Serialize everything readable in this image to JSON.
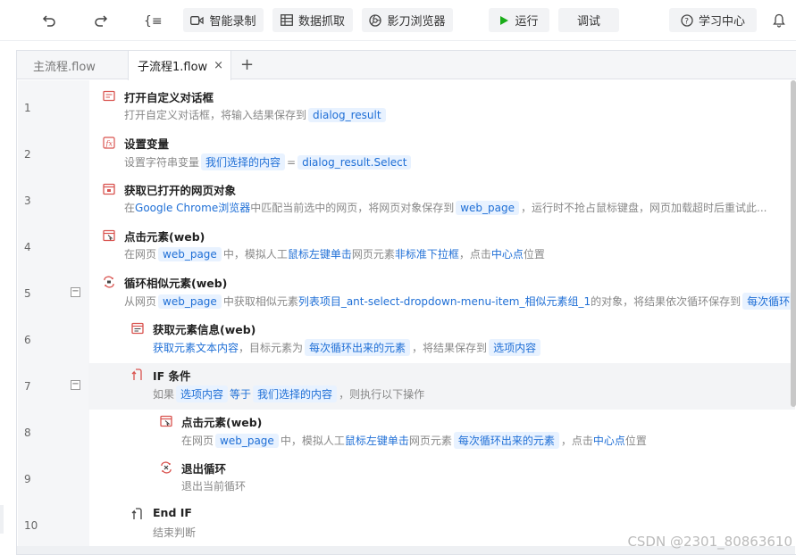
{
  "toolbar": {
    "smart_record": "智能录制",
    "data_capture": "数据抓取",
    "browser": "影刀浏览器",
    "run": "运行",
    "debug": "调试",
    "learning_center": "学习中心"
  },
  "tabs": [
    {
      "label": "主流程.flow"
    },
    {
      "label": "子流程1.flow",
      "close": "×"
    }
  ],
  "add_tab": "+",
  "rows": [
    {
      "n": "1",
      "title": "打开自定义对话框",
      "d1": "打开自定义对话框，将输入结果保存到",
      "c1": "dialog_result"
    },
    {
      "n": "2",
      "title": "设置变量",
      "d1": "设置字符串变量",
      "c1": "我们选择的内容",
      "d2": "=",
      "c2": "dialog_result.Select"
    },
    {
      "n": "3",
      "title": "获取已打开的网页对象",
      "d1": "在",
      "l1": "Google Chrome浏览器",
      "d2": "中匹配当前选中的网页，将网页对象保存到",
      "c1": "web_page",
      "d3": "，运行时不抢占鼠标键盘，网页加载超时后重试此..."
    },
    {
      "n": "4",
      "title": "点击元素(web)",
      "d1": "在网页",
      "c1": "web_page",
      "d2": "中，模拟人工",
      "l1": "鼠标左键单击",
      "d3": "网页元素",
      "l2": "非标准下拉框",
      "d4": "，点击",
      "l3": "中心点",
      "d5": "位置"
    },
    {
      "n": "5",
      "title": "循环相似元素(web)",
      "d1": "从网页",
      "c1": "web_page",
      "d2": "中获取相似元素",
      "l1": "列表项目_ant-select-dropdown-menu-item_相似元素组_1",
      "d3": "的对象，将结果依次循环保存到",
      "c2": "每次循环出"
    },
    {
      "n": "6",
      "title": "获取元素信息(web)",
      "l1": "获取元素文本内容",
      "d1": "，目标元素为",
      "c1": "每次循环出来的元素",
      "d2": "，将结果保存到",
      "c2": "选项内容"
    },
    {
      "n": "7",
      "title": "IF 条件",
      "d1": "如果",
      "c1": "选项内容",
      "l1": "等于",
      "c2": "我们选择的内容",
      "d2": "，则执行以下操作"
    },
    {
      "n": "8",
      "title": "点击元素(web)",
      "d1": "在网页",
      "c1": "web_page",
      "d2": "中，模拟人工",
      "l1": "鼠标左键单击",
      "d3": "网页元素",
      "c2": "每次循环出来的元素",
      "d4": "，点击",
      "l2": "中心点",
      "d5": "位置"
    },
    {
      "n": "9",
      "title": "退出循环",
      "d1": "退出当前循环"
    },
    {
      "n": "10",
      "title": "End IF",
      "d1": "结束判断"
    }
  ],
  "collapse_symbol": "−",
  "watermark": "CSDN @2301_80863610",
  "colors": {
    "accent": "#1f6fd6",
    "run_green": "#1aad19",
    "chip_bg": "#e8f2ff"
  }
}
